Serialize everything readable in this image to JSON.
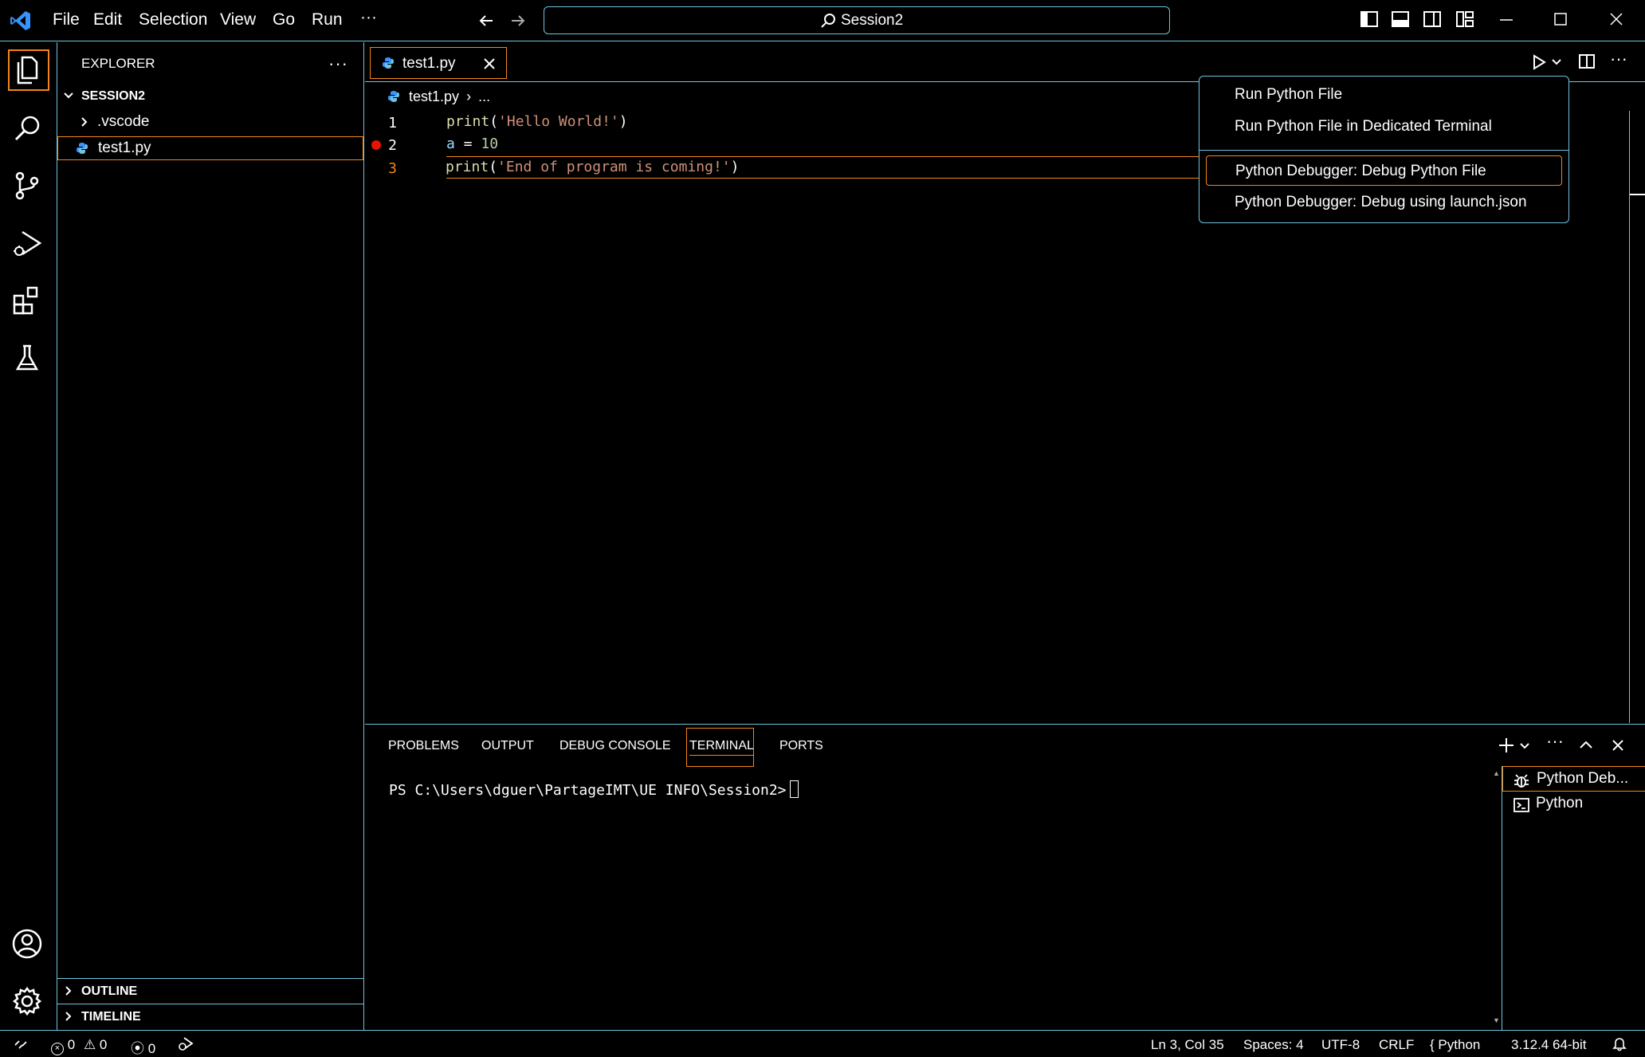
{
  "titlebar": {
    "menus": [
      "File",
      "Edit",
      "Selection",
      "View",
      "Go",
      "Run",
      "···"
    ],
    "search_text": "Session2"
  },
  "sidebar": {
    "title": "EXPLORER",
    "root": "SESSION2",
    "items": [
      ".vscode",
      "test1.py"
    ],
    "outline": "OUTLINE",
    "timeline": "TIMELINE"
  },
  "editor": {
    "tab_label": "test1.py",
    "breadcrumb_file": "test1.py",
    "breadcrumb_more": "...",
    "lines": [
      {
        "num": "1",
        "fn": "print",
        "open": "(",
        "str": "'Hello World!'",
        "close": ")"
      },
      {
        "num": "2",
        "var": "a",
        "op": " = ",
        "num_val": "10"
      },
      {
        "num": "3",
        "fn": "print",
        "open": "(",
        "str": "'End of program is coming!'",
        "close": ")"
      }
    ]
  },
  "run_menu": {
    "items": [
      "Run Python File",
      "Run Python File in Dedicated Terminal",
      "Python Debugger: Debug Python File",
      "Python Debugger: Debug using launch.json"
    ]
  },
  "panel": {
    "tabs": [
      "PROBLEMS",
      "OUTPUT",
      "DEBUG CONSOLE",
      "TERMINAL",
      "PORTS"
    ],
    "prompt": "PS C:\\Users\\dguer\\PartageIMT\\UE INFO\\Session2>",
    "terminals": [
      "Python Deb...",
      "Python"
    ]
  },
  "statusbar": {
    "errors": "0",
    "warnings": "0",
    "ports": "0",
    "position": "Ln 3, Col 35",
    "spaces": "Spaces: 4",
    "encoding": "UTF-8",
    "eol": "CRLF",
    "language": "Python",
    "interpreter": "3.12.4 64-bit"
  },
  "colors": {
    "contrast_border": "#6fc3df",
    "active_border": "#f38518",
    "breakpoint": "#e51400",
    "vscode_blue": "#3794ff"
  }
}
